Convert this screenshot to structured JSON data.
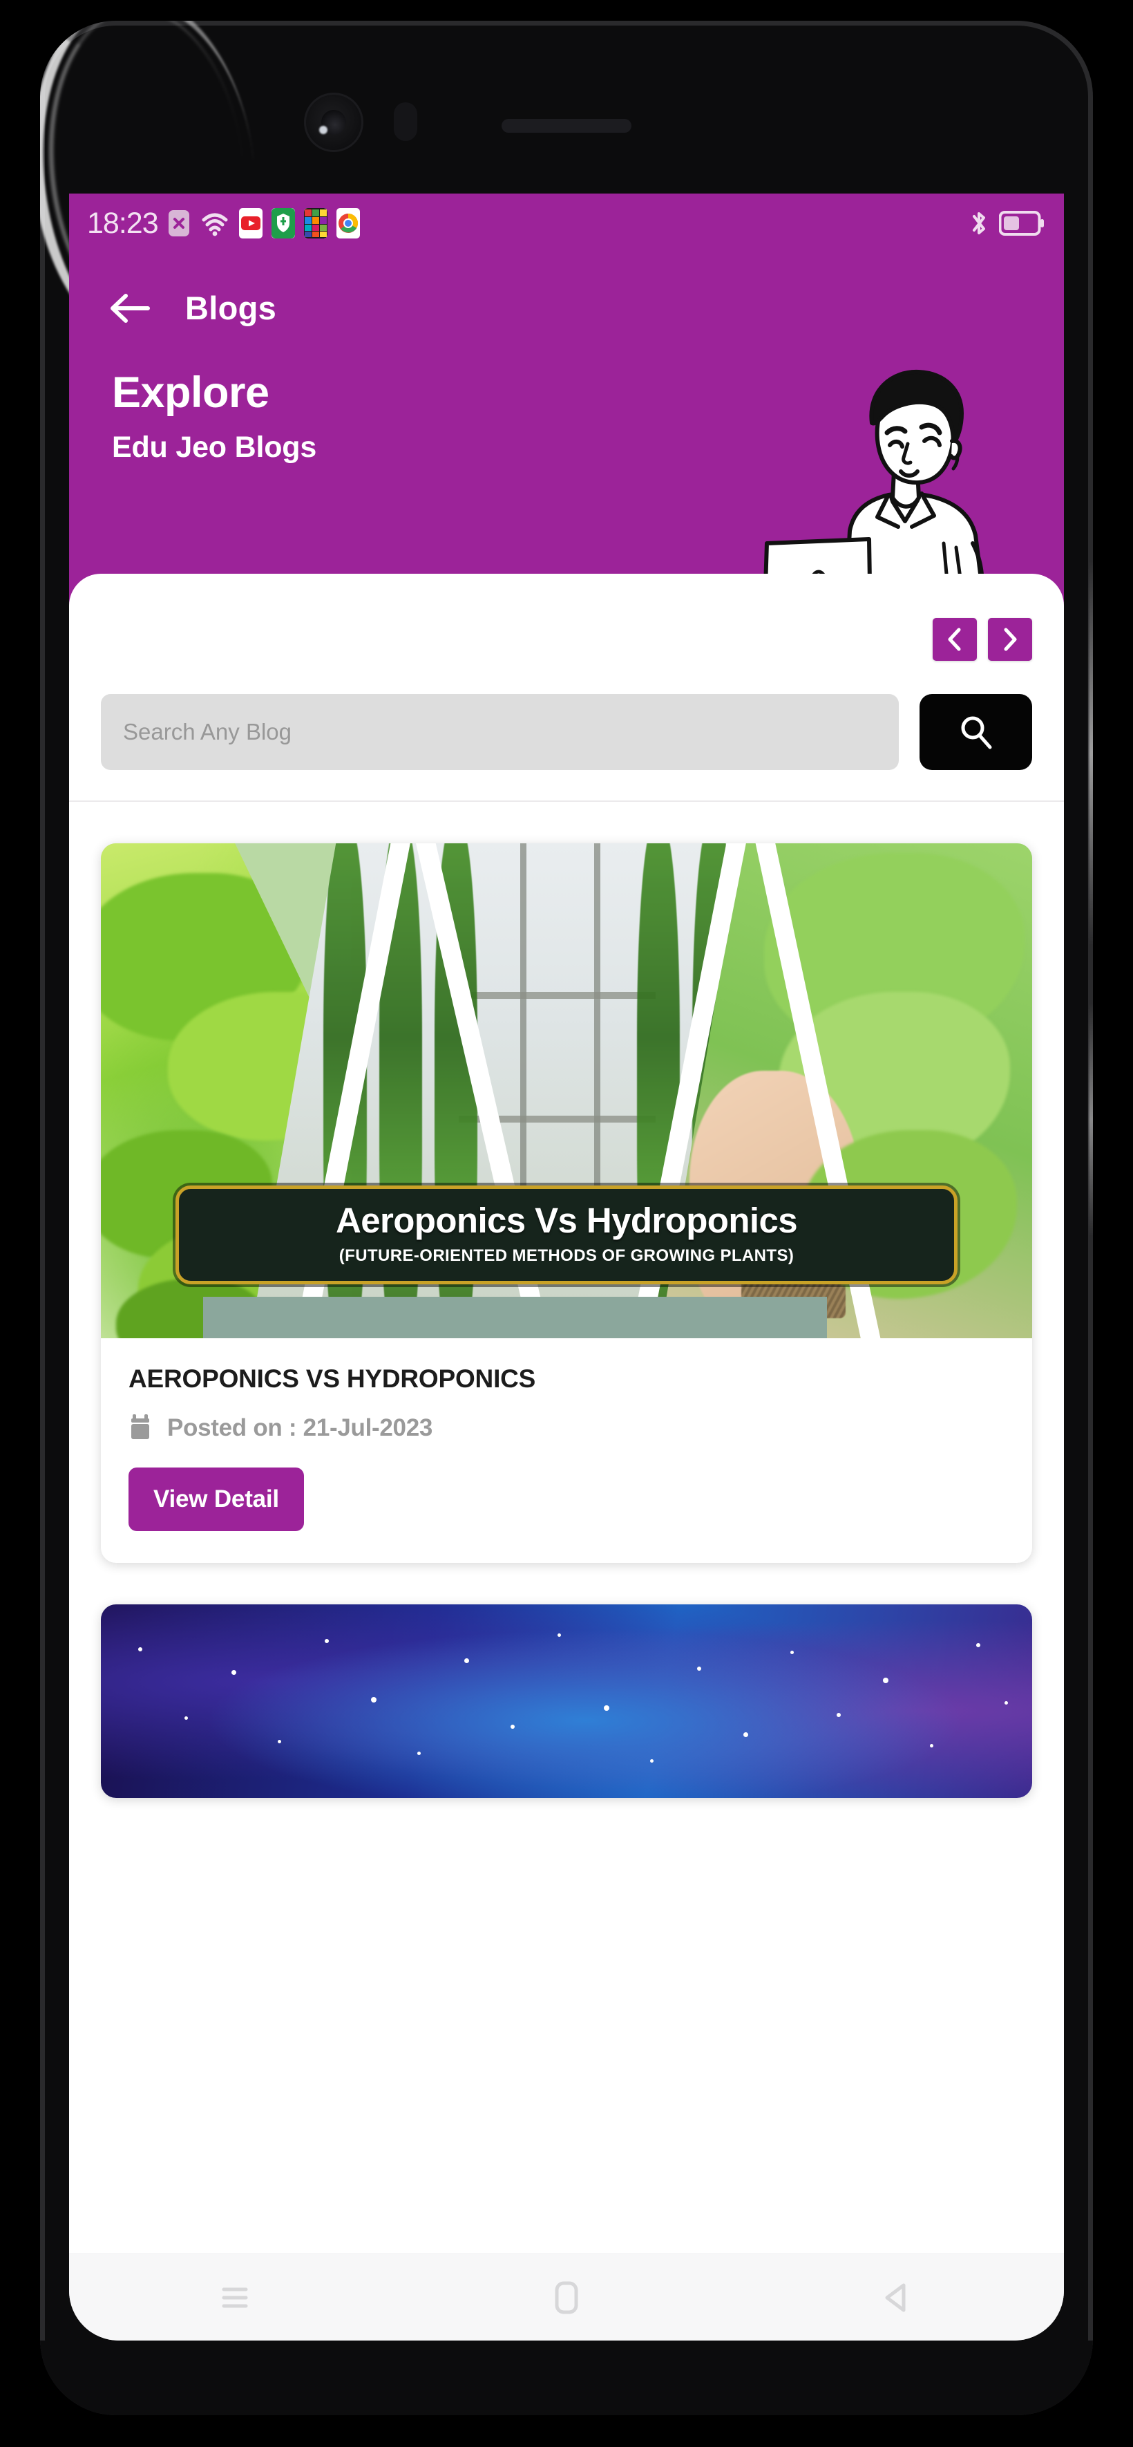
{
  "status_bar": {
    "time": "18:23",
    "icons_left": [
      "mute-icon",
      "wifi-icon",
      "youtube-app-icon",
      "shield-app-icon",
      "colorful-app-icon",
      "chrome-app-icon"
    ],
    "icons_right": [
      "bluetooth-icon",
      "battery-icon"
    ],
    "battery_level": "45"
  },
  "header": {
    "back_label": "back-arrow",
    "title": "Blogs",
    "hero_title": "Explore",
    "hero_subtitle": "Edu Jeo Blogs",
    "illustration": "person-with-laptop-illustration",
    "background_color": "#9c2399"
  },
  "pagination": {
    "prev_label": "‹",
    "next_label": "›"
  },
  "search": {
    "placeholder": "Search Any Blog",
    "value": "",
    "button_icon": "search-icon"
  },
  "blogs": [
    {
      "thumb_title": "Aeroponics Vs Hydroponics",
      "thumb_subtitle": "(FUTURE-ORIENTED METHODS OF GROWING PLANTS)",
      "title": "AEROPONICS VS HYDROPONICS",
      "date_icon": "calendar-icon",
      "date": "Posted on : 21-Jul-2023",
      "button_label": "View Detail"
    },
    {
      "thumb_title": "",
      "thumb_subtitle": "",
      "title": "",
      "date_icon": "calendar-icon",
      "date": "",
      "button_label": ""
    }
  ],
  "nav_bar": {
    "recents": "recents-icon",
    "home": "home-icon",
    "back": "back-nav-icon"
  },
  "colors": {
    "brand_purple": "#9c2399",
    "search_button": "#050505",
    "search_field": "#dddddd",
    "plaque_bg": "#16241c",
    "plaque_border": "#c9a227"
  }
}
